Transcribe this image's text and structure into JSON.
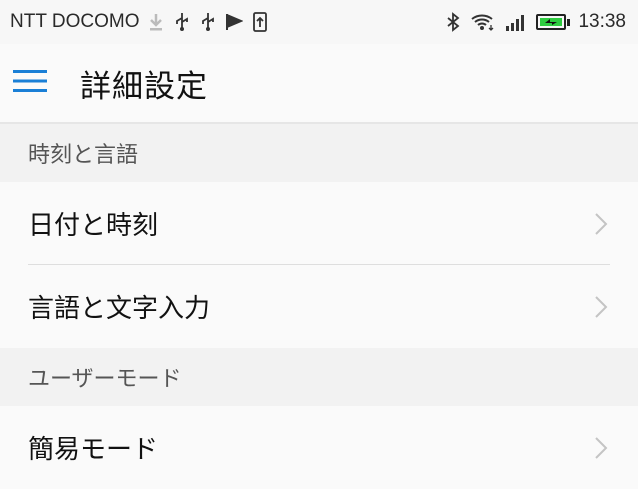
{
  "status_bar": {
    "carrier": "NTT DOCOMO",
    "time": "13:38",
    "icons": [
      "download-icon",
      "usb-icon",
      "usb-icon",
      "flag-icon",
      "upload-icon",
      "bluetooth-icon",
      "wifi-icon",
      "signal-icon",
      "battery-charging-icon"
    ],
    "battery_color": "#2ecc40"
  },
  "toolbar": {
    "title": "詳細設定",
    "menu_icon_color": "#1a7fd6"
  },
  "sections": [
    {
      "header": "時刻と言語",
      "items": [
        {
          "label": "日付と時刻"
        },
        {
          "label": "言語と文字入力"
        }
      ]
    },
    {
      "header": "ユーザーモード",
      "items": [
        {
          "label": "簡易モード"
        }
      ]
    }
  ]
}
